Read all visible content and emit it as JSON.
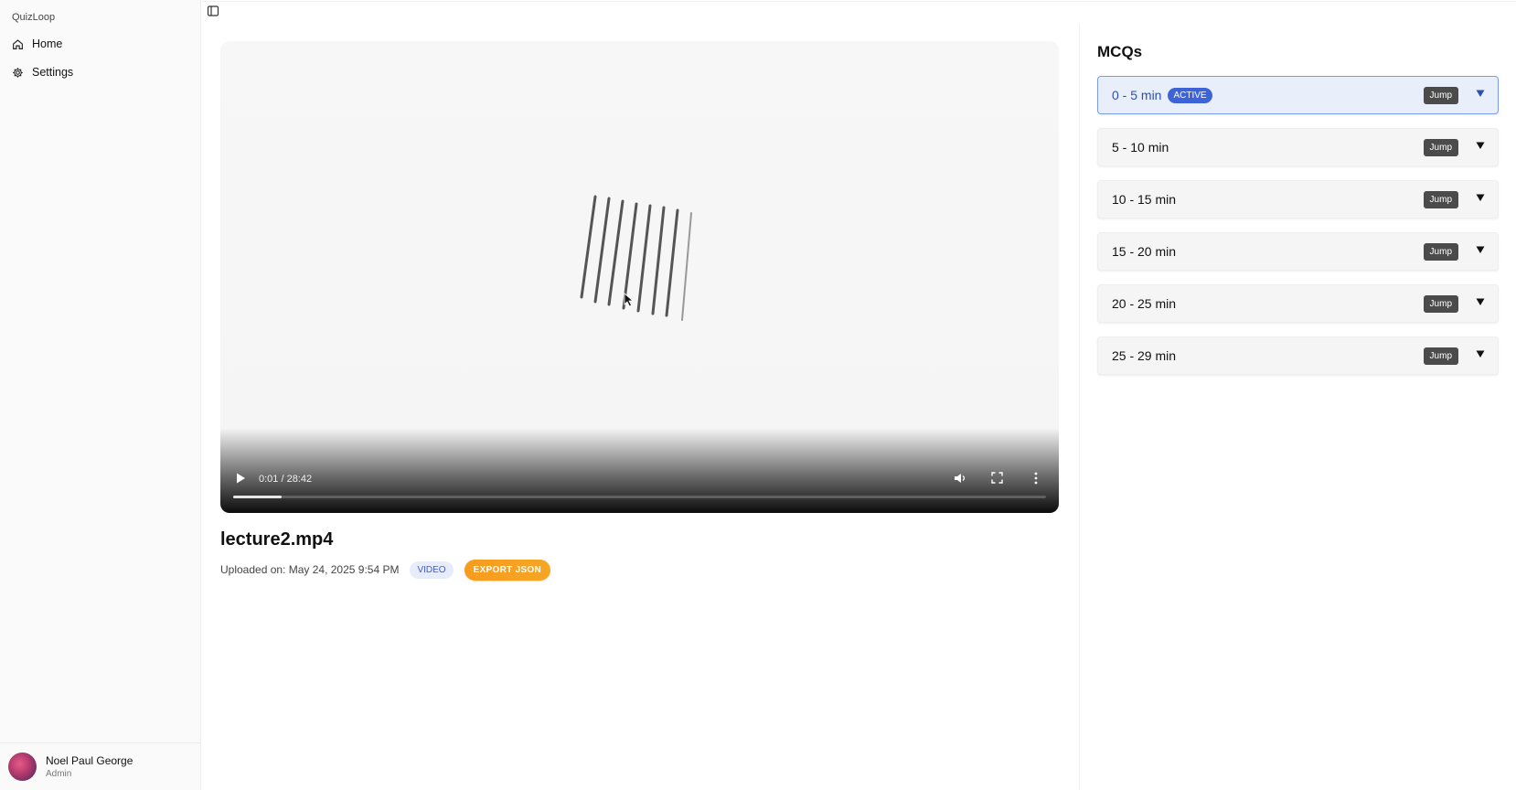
{
  "app": {
    "brand": "QuizLoop"
  },
  "sidebar": {
    "items": [
      {
        "label": "Home",
        "icon": "home-icon"
      },
      {
        "label": "Settings",
        "icon": "gear-icon"
      }
    ],
    "user": {
      "name": "Noel Paul George",
      "role": "Admin"
    }
  },
  "video": {
    "time": "0:01 / 28:42",
    "progress_fraction": 0.06
  },
  "file": {
    "title": "lecture2.mp4",
    "uploaded": "Uploaded on: May 24, 2025 9:54 PM",
    "type_badge": "VIDEO",
    "export_label": "EXPORT JSON"
  },
  "mcqs": {
    "title": "MCQs",
    "active_badge": "ACTIVE",
    "jump_label": "Jump",
    "segments": [
      {
        "label": "0 - 5 min",
        "active": true
      },
      {
        "label": "5 - 10 min",
        "active": false
      },
      {
        "label": "10 - 15 min",
        "active": false
      },
      {
        "label": "15 - 20 min",
        "active": false
      },
      {
        "label": "20 - 25 min",
        "active": false
      },
      {
        "label": "25 - 29 min",
        "active": false
      }
    ]
  },
  "colors": {
    "accent": "#3d63d9",
    "export": "#f79b1f",
    "active_bg": "#e9eefb"
  }
}
